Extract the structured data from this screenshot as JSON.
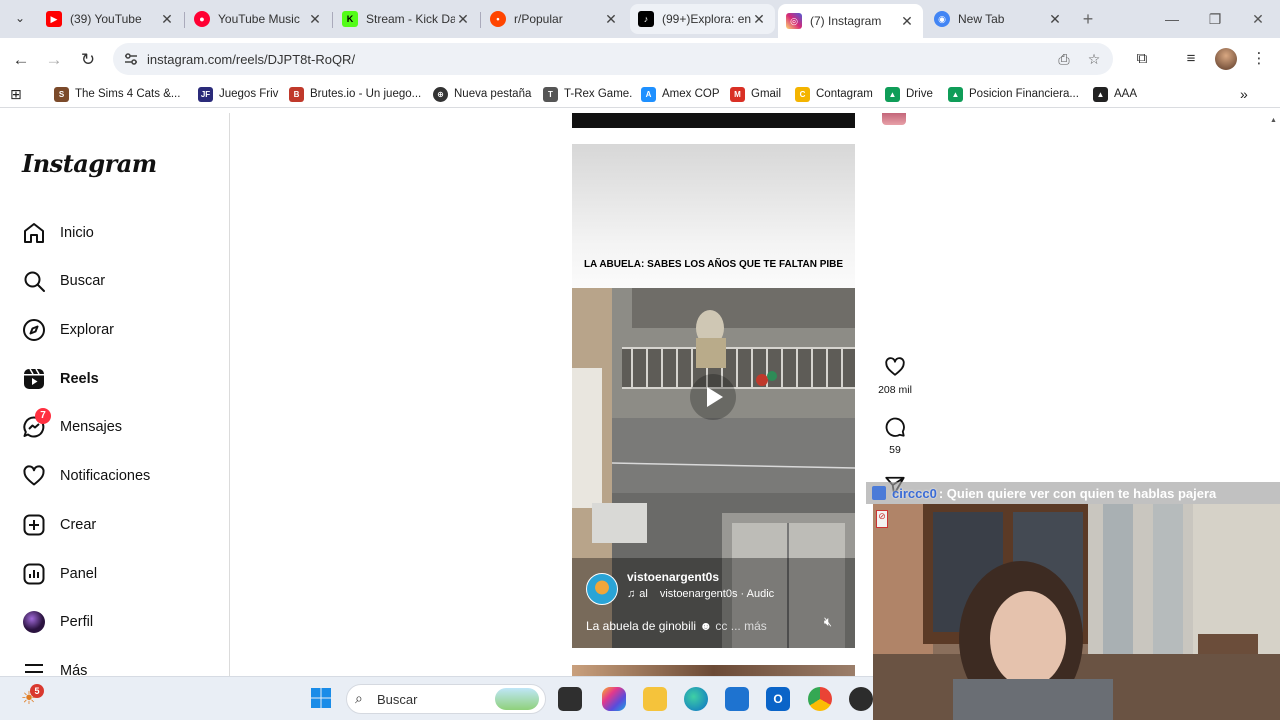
{
  "browser": {
    "tabs": [
      {
        "title": "(39) YouTube",
        "favicon": "youtube-icon",
        "color": "#ff0000"
      },
      {
        "title": "YouTube Music",
        "favicon": "youtube-music-icon",
        "color": "#ff0033"
      },
      {
        "title": "Stream - Kick Da",
        "favicon": "kick-icon",
        "color": "#53fc18"
      },
      {
        "title": "r/Popular",
        "favicon": "reddit-icon",
        "color": "#ff4500"
      },
      {
        "title": "(99+)Explora: en",
        "favicon": "tiktok-icon",
        "color": "#000000"
      },
      {
        "title": "(7) Instagram",
        "favicon": "instagram-icon",
        "color": "#d62976"
      },
      {
        "title": "New Tab",
        "favicon": "chrome-icon",
        "color": "#4285f4"
      }
    ],
    "url": "instagram.com/reels/DJPT8t-RoQR/",
    "bookmarks": [
      {
        "label": "The Sims 4 Cats &...",
        "color": "#7b4a2a"
      },
      {
        "label": "Juegos Friv",
        "color": "#2b2b7a"
      },
      {
        "label": "Brutes.io - Un juego...",
        "color": "#c0392b"
      },
      {
        "label": "Nueva pestaña",
        "color": "#333333"
      },
      {
        "label": "T-Rex Game.",
        "color": "#555555"
      },
      {
        "label": "Amex COP",
        "color": "#1e90ff"
      },
      {
        "label": "Gmail",
        "color": "#d93025"
      },
      {
        "label": "Contagram",
        "color": "#f4b400"
      },
      {
        "label": "Drive",
        "color": "#0f9d58"
      },
      {
        "label": "Posicion Financiera...",
        "color": "#0f9d58"
      },
      {
        "label": "AAA",
        "color": "#222222"
      }
    ]
  },
  "instagram": {
    "logo": "Instagram",
    "nav": [
      {
        "label": "Inicio",
        "icon": "home-icon"
      },
      {
        "label": "Buscar",
        "icon": "search-icon"
      },
      {
        "label": "Explorar",
        "icon": "explore-icon"
      },
      {
        "label": "Reels",
        "icon": "reels-icon",
        "active": true
      },
      {
        "label": "Mensajes",
        "icon": "messages-icon",
        "badge": "7"
      },
      {
        "label": "Notificaciones",
        "icon": "heart-icon"
      },
      {
        "label": "Crear",
        "icon": "create-icon"
      },
      {
        "label": "Panel",
        "icon": "dashboard-icon"
      },
      {
        "label": "Perfil",
        "icon": "profile-avatar"
      },
      {
        "label": "Más",
        "icon": "menu-icon"
      }
    ],
    "reel": {
      "overlay_text": "LA ABUELA: SABES LOS AÑOS QUE TE FALTAN PIBE",
      "username": "vistoenargent0s",
      "audio_prefix": "al",
      "audio": "vistoenargent0s · Audic",
      "caption": "La abuela de ginobili",
      "caption_more": "cc ... más",
      "likes": "208 mil",
      "comments": "59"
    }
  },
  "stream": {
    "chat_user": "circcc0",
    "chat_message": ": Quien quiere ver con quien te hablas pajera"
  },
  "taskbar": {
    "search_placeholder": "Buscar",
    "weather_badge": "5"
  }
}
